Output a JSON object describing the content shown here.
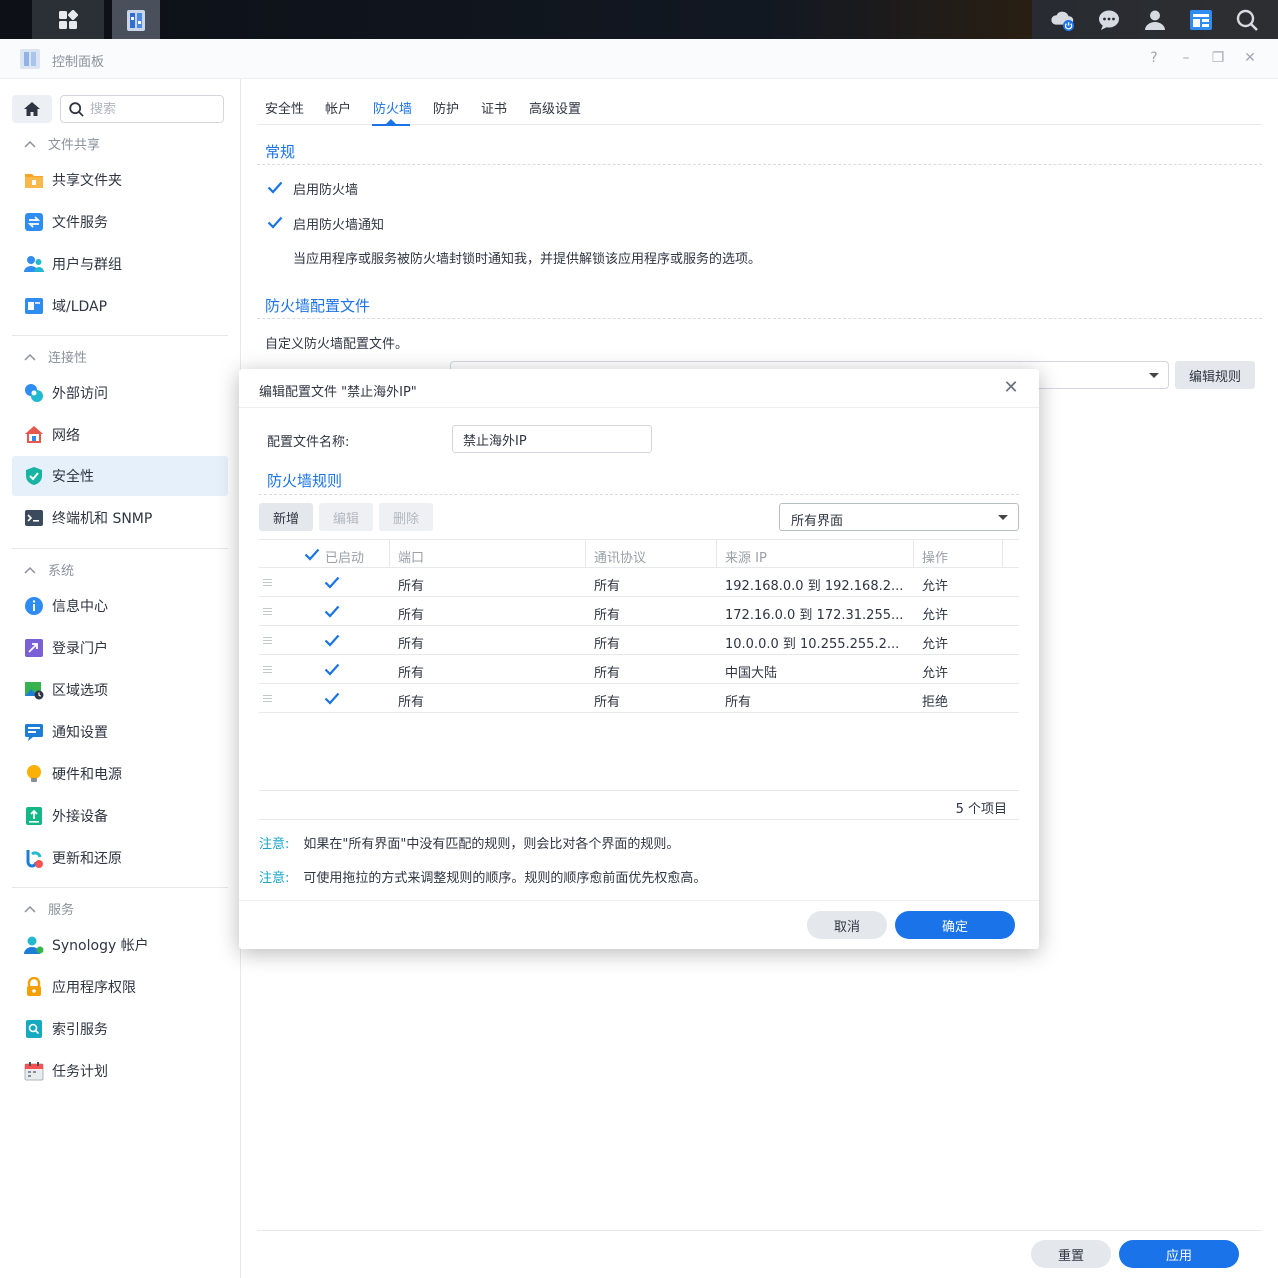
{
  "window": {
    "title": "控制面板"
  },
  "search": {
    "placeholder": "搜索"
  },
  "sidebar": {
    "sections": [
      {
        "title": "文件共享",
        "items": [
          "共享文件夹",
          "文件服务",
          "用户与群组",
          "域/LDAP"
        ]
      },
      {
        "title": "连接性",
        "items": [
          "外部访问",
          "网络",
          "安全性",
          "终端机和 SNMP"
        ]
      },
      {
        "title": "系统",
        "items": [
          "信息中心",
          "登录门户",
          "区域选项",
          "通知设置",
          "硬件和电源",
          "外接设备",
          "更新和还原"
        ]
      },
      {
        "title": "服务",
        "items": [
          "Synology 帐户",
          "应用程序权限",
          "索引服务",
          "任务计划"
        ]
      }
    ],
    "active_item": "安全性"
  },
  "tabs": [
    "安全性",
    "帐户",
    "防火墙",
    "防护",
    "证书",
    "高级设置"
  ],
  "active_tab": "防火墙",
  "general": {
    "title": "常规",
    "enable_firewall": "启用防火墙",
    "enable_notify": "启用防火墙通知",
    "notify_desc": "当应用程序或服务被防火墙封锁时通知我，并提供解锁该应用程序或服务的选项。"
  },
  "profile": {
    "title": "防火墙配置文件",
    "desc": "自定义防火墙配置文件。",
    "select_value": "",
    "edit_rules": "编辑规则"
  },
  "footer": {
    "reset": "重置",
    "apply": "应用"
  },
  "modal": {
    "title": "编辑配置文件 \"禁止海外IP\"",
    "name_label": "配置文件名称:",
    "name_value": "禁止海外IP",
    "rules_title": "防火墙规则",
    "add": "新增",
    "edit": "编辑",
    "delete": "删除",
    "interface": "所有界面",
    "columns": [
      "已启动",
      "端口",
      "通讯协议",
      "来源 IP",
      "操作"
    ],
    "rows": [
      {
        "port": "所有",
        "protocol": "所有",
        "source": "192.168.0.0 到 192.168.2...",
        "action": "允许"
      },
      {
        "port": "所有",
        "protocol": "所有",
        "source": "172.16.0.0 到 172.31.255...",
        "action": "允许"
      },
      {
        "port": "所有",
        "protocol": "所有",
        "source": "10.0.0.0 到 10.255.255.2...",
        "action": "允许"
      },
      {
        "port": "所有",
        "protocol": "所有",
        "source": "中国大陆",
        "action": "允许"
      },
      {
        "port": "所有",
        "protocol": "所有",
        "source": "所有",
        "action": "拒绝"
      }
    ],
    "count": "5 个项目",
    "note_label": "注意:",
    "note1": "如果在\"所有界面\"中没有匹配的规则，则会比对各个界面的规则。",
    "note2": "可使用拖拉的方式来调整规则的顺序。规则的顺序愈前面优先权愈高。",
    "cancel": "取消",
    "ok": "确定"
  },
  "colors": {
    "accent": "#1a73e8",
    "active_bg": "#e6f0fb",
    "note": "#1aa4c7"
  }
}
